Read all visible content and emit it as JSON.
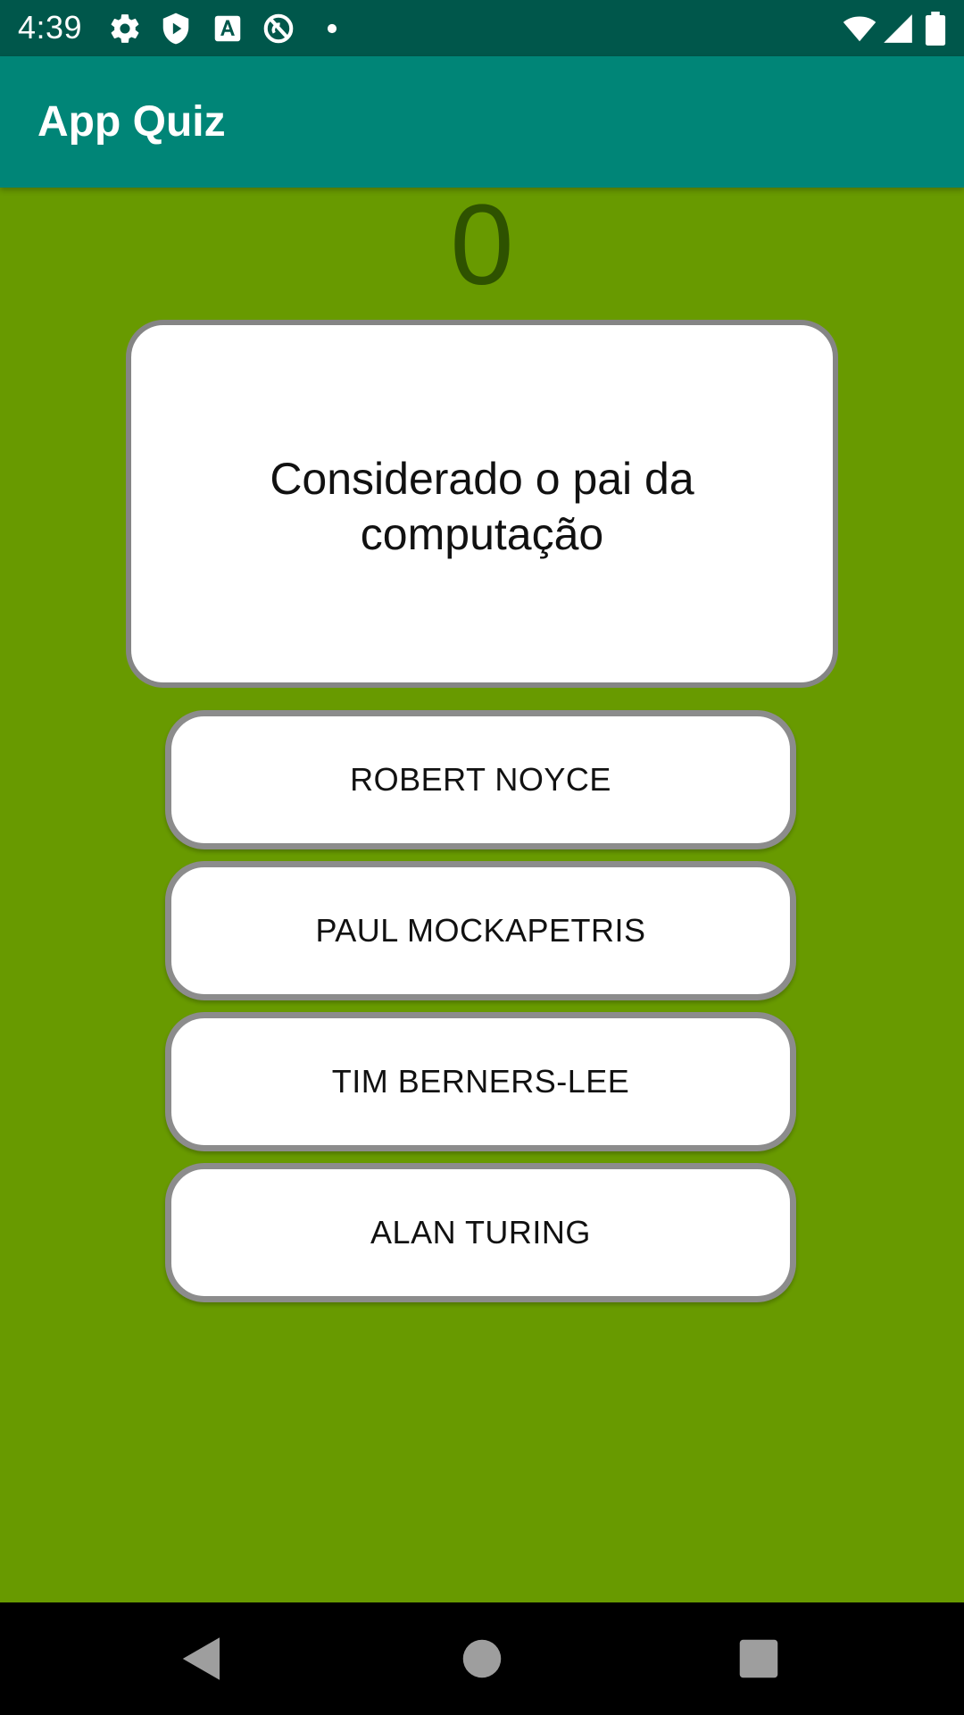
{
  "status_bar": {
    "time": "4:39",
    "left_icons": [
      "settings-icon",
      "shield-icon",
      "font-a-icon",
      "no-sim-icon",
      "dot-icon"
    ],
    "right_icons": [
      "wifi-icon",
      "signal-icon",
      "battery-icon"
    ]
  },
  "app_bar": {
    "title": "App Quiz"
  },
  "quiz": {
    "score": "0",
    "question": "Considerado o pai da computação",
    "answers": [
      "ROBERT NOYCE",
      "PAUL MOCKAPETRIS",
      "TIM BERNERS-LEE",
      "ALAN TURING"
    ]
  },
  "nav_bar": {
    "buttons": [
      "back-icon",
      "home-icon",
      "recents-icon"
    ]
  },
  "colors": {
    "status_bar": "#00574b",
    "app_bar": "#008577",
    "background": "#689a00",
    "score_text": "#2e5200",
    "card_border": "#858585"
  }
}
